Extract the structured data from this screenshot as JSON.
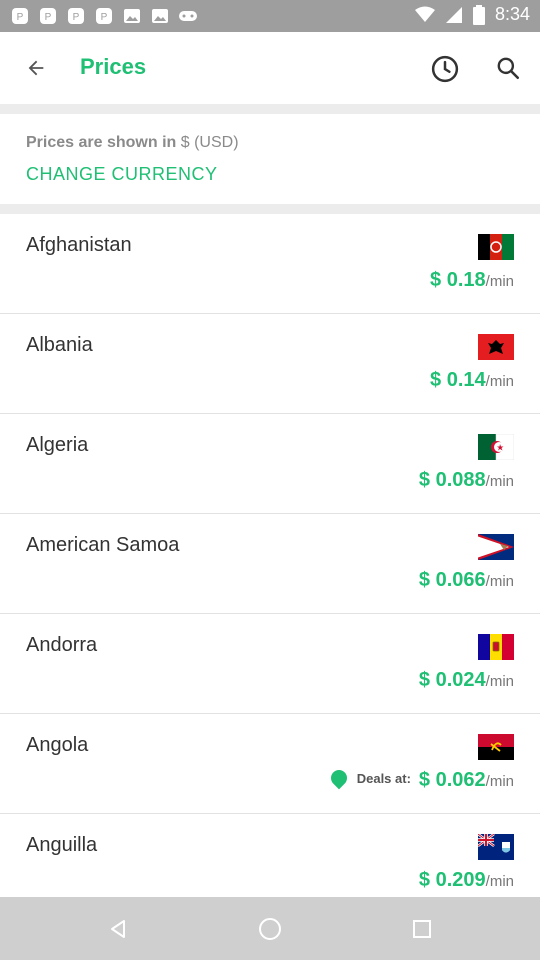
{
  "status_bar": {
    "time": "8:34",
    "left_icons": [
      "app-notification-icon",
      "app-notification-icon",
      "app-notification-icon",
      "app-notification-icon",
      "image-icon",
      "image-icon",
      "gamepad-icon"
    ],
    "right_icons": [
      "wifi-icon",
      "signal-icon",
      "battery-icon"
    ]
  },
  "app_bar": {
    "title": "Prices"
  },
  "currency": {
    "label": "Prices are shown in",
    "value": "$ (USD)",
    "change_label": "CHANGE CURRENCY"
  },
  "countries": [
    {
      "name": "Afghanistan",
      "price": "$ 0.18",
      "unit": "/min",
      "deal": false
    },
    {
      "name": "Albania",
      "price": "$ 0.14",
      "unit": "/min",
      "deal": false
    },
    {
      "name": "Algeria",
      "price": "$ 0.088",
      "unit": "/min",
      "deal": false
    },
    {
      "name": "American Samoa",
      "price": "$ 0.066",
      "unit": "/min",
      "deal": false
    },
    {
      "name": "Andorra",
      "price": "$ 0.024",
      "unit": "/min",
      "deal": false
    },
    {
      "name": "Angola",
      "price": "$ 0.062",
      "unit": "/min",
      "deal": true,
      "deal_label": "Deals at:"
    },
    {
      "name": "Anguilla",
      "price": "$ 0.209",
      "unit": "/min",
      "deal": false
    }
  ],
  "colors": {
    "accent": "#1fbf74",
    "status_bar": "#9e9e9e",
    "nav_bar": "#cfcfcf"
  }
}
